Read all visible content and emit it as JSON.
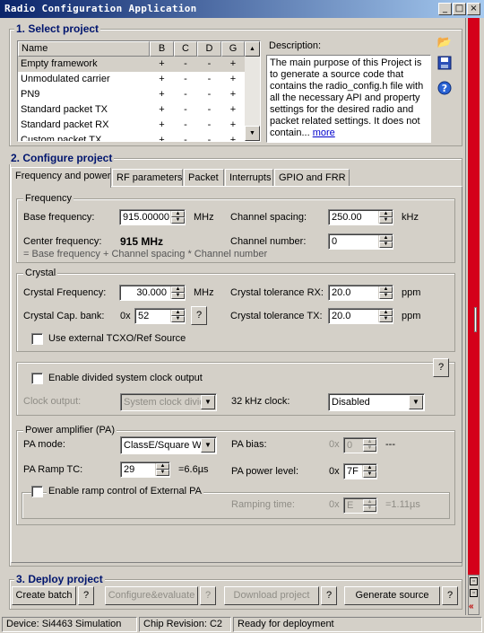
{
  "window": {
    "title": "Radio Configuration Application"
  },
  "section1": {
    "title": "1. Select project",
    "columns": [
      "Name",
      "B",
      "C",
      "D",
      "G"
    ],
    "rows": [
      {
        "name": "Empty framework",
        "b": "+",
        "c": "-",
        "d": "-",
        "g": "+"
      },
      {
        "name": "Unmodulated carrier",
        "b": "+",
        "c": "-",
        "d": "-",
        "g": "+"
      },
      {
        "name": "PN9",
        "b": "+",
        "c": "-",
        "d": "-",
        "g": "+"
      },
      {
        "name": "Standard packet TX",
        "b": "+",
        "c": "-",
        "d": "-",
        "g": "+"
      },
      {
        "name": "Standard packet RX",
        "b": "+",
        "c": "-",
        "d": "-",
        "g": "+"
      },
      {
        "name": "Custom packet TX",
        "b": "+",
        "c": "-",
        "d": "-",
        "g": "+"
      }
    ],
    "description_label": "Description:",
    "description_text": "The main purpose of this Project is to generate a source code that contains the radio_config.h file with all the necessary API and property settings for the desired radio and packet related settings. It does not contain...",
    "more_link": "more"
  },
  "section2": {
    "title": "2. Configure project",
    "tabs": [
      "Frequency and power",
      "RF parameters",
      "Packet",
      "Interrupts",
      "GPIO and FRR"
    ],
    "frequency": {
      "group": "Frequency",
      "base_label": "Base frequency:",
      "base_value": "915.00000",
      "base_unit": "MHz",
      "spacing_label": "Channel spacing:",
      "spacing_value": "250.00",
      "spacing_unit": "kHz",
      "center_label": "Center frequency:",
      "center_value": "915 MHz",
      "channel_label": "Channel number:",
      "channel_value": "0",
      "formula": "= Base frequency + Channel spacing * Channel number"
    },
    "crystal": {
      "group": "Crystal",
      "freq_label": "Crystal Frequency:",
      "freq_value": "30.000",
      "freq_unit": "MHz",
      "tol_rx_label": "Crystal tolerance RX:",
      "tol_rx_value": "20.0",
      "tol_rx_unit": "ppm",
      "cap_label": "Crystal Cap. bank:",
      "cap_prefix": "0x",
      "cap_value": "52",
      "tol_tx_label": "Crystal tolerance TX:",
      "tol_tx_value": "20.0",
      "tol_tx_unit": "ppm",
      "tcxo_label": "Use external TCXO/Ref Source",
      "help": "?"
    },
    "clock": {
      "divided_label": "Enable divided system clock output",
      "output_label": "Clock output:",
      "output_value": "System clock divid",
      "k32_label": "32 kHz clock:",
      "k32_value": "Disabled",
      "help": "?"
    },
    "pa": {
      "group": "Power amplifier (PA)",
      "mode_label": "PA mode:",
      "mode_value": "ClassE/Square W",
      "bias_label": "PA bias:",
      "bias_prefix": "0x",
      "bias_value": "0",
      "bias_suffix": "---",
      "ramp_label": "PA Ramp TC:",
      "ramp_value": "29",
      "ramp_time": "=6.6µs",
      "level_label": "PA power level:",
      "level_prefix": "0x",
      "level_value": "7F",
      "ext_label": "Enable ramp control of External PA",
      "ramping_label": "Ramping time:",
      "ramping_prefix": "0x",
      "ramping_value": "E",
      "ramping_time": "=1.11µs"
    }
  },
  "section3": {
    "title": "3. Deploy project",
    "create": "Create batch",
    "configure": "Configure&evaluate",
    "download": "Download project",
    "generate": "Generate source",
    "help": "?"
  },
  "status": {
    "device": "Device: Si4463  Simulation",
    "chip": "Chip Revision: C2",
    "state": "Ready for deployment"
  },
  "icons": [
    "open-folder-icon",
    "save-disk-icon",
    "help-icon",
    "collapse-icon"
  ]
}
